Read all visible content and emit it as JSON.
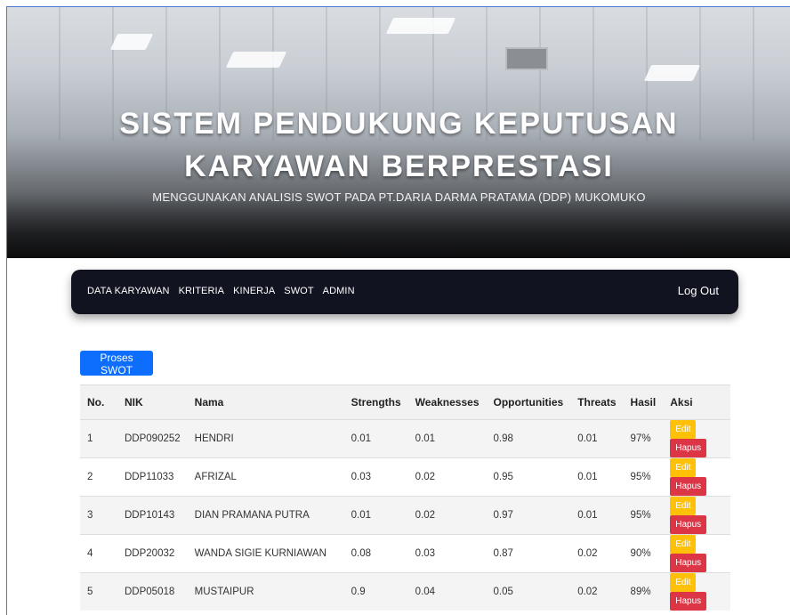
{
  "hero": {
    "title_line1": "SISTEM PENDUKUNG KEPUTUSAN",
    "title_line2": "KARYAWAN BERPRESTASI",
    "subtitle": "MENGGUNAKAN ANALISIS SWOT PADA PT.DARIA DARMA PRATAMA (DDP) MUKOMUKO"
  },
  "nav": {
    "items": [
      "DATA KARYAWAN",
      "KRITERIA",
      "KINERJA",
      "SWOT",
      "ADMIN"
    ],
    "logout": "Log Out"
  },
  "actions": {
    "proses_swot": "Proses SWOT",
    "edit": "Edit",
    "hapus": "Hapus"
  },
  "table": {
    "headers": [
      "No.",
      "NIK",
      "Nama",
      "Strengths",
      "Weaknesses",
      "Opportunities",
      "Threats",
      "Hasil",
      "Aksi"
    ],
    "rows": [
      [
        "1",
        "DDP090252",
        "HENDRI",
        "0.01",
        "0.01",
        "0.98",
        "0.01",
        "97%"
      ],
      [
        "2",
        "DDP11033",
        "AFRIZAL",
        "0.03",
        "0.02",
        "0.95",
        "0.01",
        "95%"
      ],
      [
        "3",
        "DDP10143",
        "DIAN PRAMANA PUTRA",
        "0.01",
        "0.02",
        "0.97",
        "0.01",
        "95%"
      ],
      [
        "4",
        "DDP20032",
        "WANDA SIGIE KURNIAWAN",
        "0.08",
        "0.03",
        "0.87",
        "0.02",
        "90%"
      ],
      [
        "5",
        "DDP05018",
        "MUSTAIPUR",
        "0.9",
        "0.04",
        "0.05",
        "0.02",
        "89%"
      ]
    ]
  },
  "colors": {
    "navbar_bg": "#121320",
    "primary": "#0d6efd",
    "warning": "#ffc107",
    "danger": "#dc3545"
  }
}
